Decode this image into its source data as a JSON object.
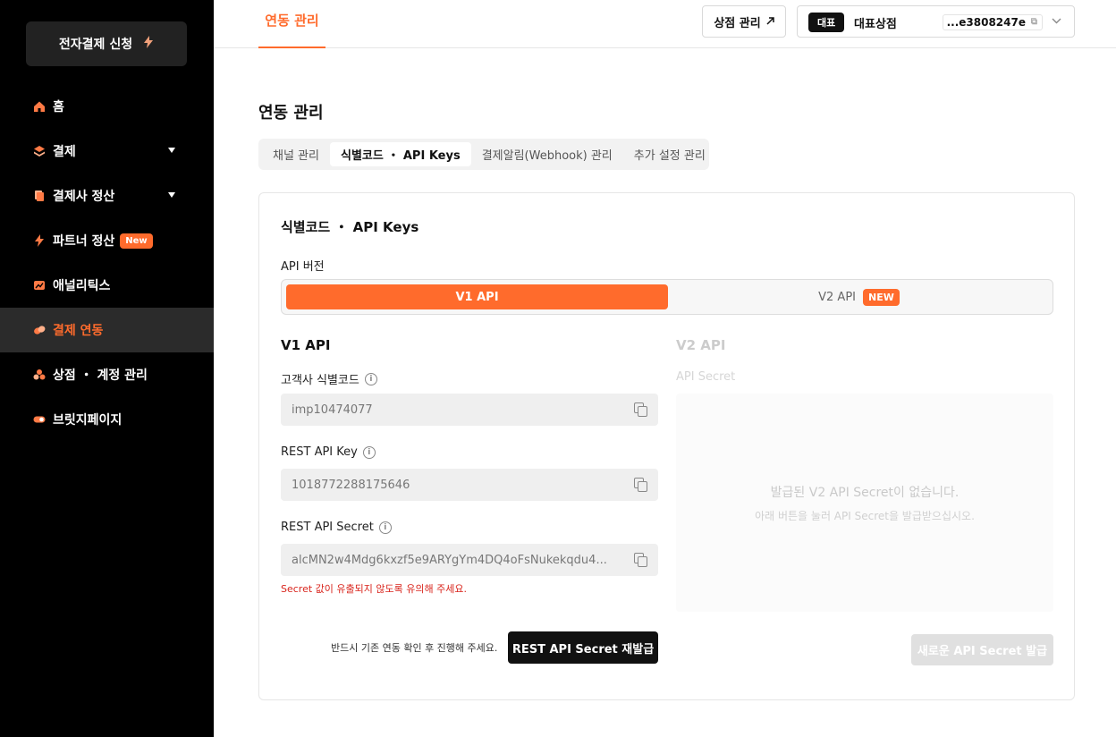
{
  "sidebar": {
    "apply_button": "전자결제 신청",
    "items": [
      {
        "label": "홈",
        "icon": "home-icon",
        "has_caret": false
      },
      {
        "label": "결제",
        "icon": "layers-icon",
        "has_caret": true
      },
      {
        "label": "결제사 정산",
        "icon": "document-icon",
        "has_caret": true
      },
      {
        "label": "파트너 정산",
        "icon": "bolt-icon",
        "badge": "New"
      },
      {
        "label": "애널리틱스",
        "icon": "chart-icon"
      },
      {
        "label": "결제 연동",
        "icon": "link-icon",
        "active": true
      },
      {
        "label": "상점 ・ 계정 관리",
        "icon": "users-icon"
      },
      {
        "label": "브릿지페이지",
        "icon": "toggle-icon"
      }
    ]
  },
  "header": {
    "tab": "연동 관리",
    "store_mgmt_button": "상점 관리",
    "store_tag": "대표",
    "store_name": "대표상점",
    "store_id": "...e3808247e"
  },
  "main": {
    "title": "연동 관리",
    "tabs": [
      "채널 관리",
      "식별코드 ・ API Keys",
      "결제알림(Webhook) 관리",
      "추가 설정 관리"
    ],
    "active_tab": 1
  },
  "card": {
    "title": "식별코드 ・ API Keys",
    "api_version_label": "API 버전",
    "v1_option": "V1 API",
    "v2_option": "V2 API",
    "v2_badge": "NEW",
    "v1": {
      "title": "V1 API",
      "fields": [
        {
          "label": "고객사 식별코드",
          "value": "imp10474077"
        },
        {
          "label": "REST API Key",
          "value": "1018772288175646"
        },
        {
          "label": "REST API Secret",
          "value": "alcMN2w4Mdg6kxzf5e9ARYgYm4DQ4oFsNukekqdu4..."
        }
      ],
      "warning": "Secret 값이 유출되지 않도록 유의해 주세요.",
      "confirm_note": "반드시 기존 연동 확인 후 진행해 주세요.",
      "reissue_button": "REST API Secret 재발급"
    },
    "v2": {
      "title": "V2 API",
      "secret_label": "API Secret",
      "empty_title": "발급된 V2 API Secret이 없습니다.",
      "empty_desc": "아래 버튼을 눌러 API Secret을 발급받으십시오.",
      "issue_button": "새로운 API Secret 발급"
    }
  },
  "colors": {
    "accent": "#ff6b2c",
    "sidebar_bg": "#000000",
    "danger": "#d9251d"
  }
}
